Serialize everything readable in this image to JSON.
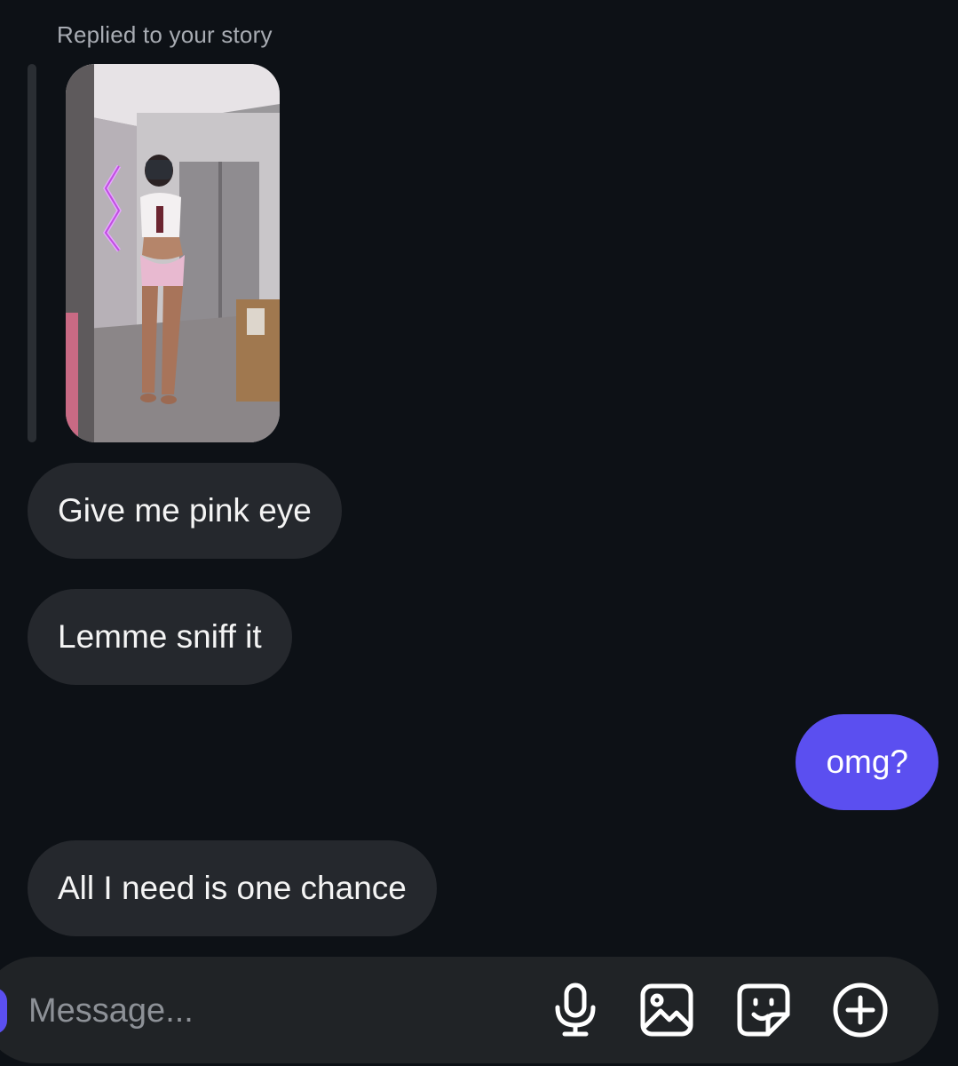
{
  "story_reply": {
    "label": "Replied to your story"
  },
  "messages": [
    {
      "direction": "incoming",
      "text": "Give me pink eye"
    },
    {
      "direction": "incoming",
      "text": "Lemme sniff it"
    },
    {
      "direction": "outgoing",
      "text": "omg?"
    },
    {
      "direction": "incoming",
      "text": "All I need is one chance"
    }
  ],
  "composer": {
    "placeholder": "Message...",
    "icons": [
      "microphone-icon",
      "image-icon",
      "sticker-icon",
      "plus-circle-icon"
    ]
  },
  "colors": {
    "background": "#0d1116",
    "incoming_bubble": "#25282d",
    "outgoing_bubble": "#5b4ff0",
    "composer": "#202326"
  }
}
